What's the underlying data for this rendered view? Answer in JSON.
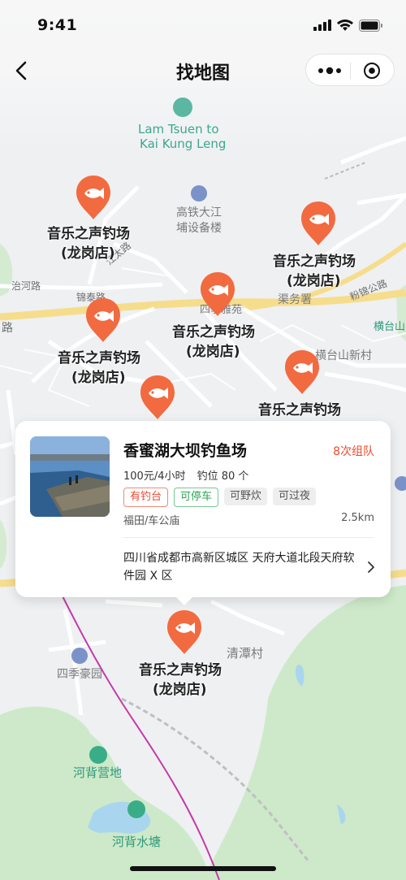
{
  "status_bar": {
    "time": "9:41"
  },
  "nav": {
    "title": "找地图"
  },
  "map_labels": {
    "lam_tsuen": "Lam Tsuen to",
    "kai_kung_leng": "Kai Kung Leng",
    "station_line1": "高铁大江",
    "station_line2": "埔设备楼",
    "zhihe_road": "治河路",
    "jintai_road": "锦泰路",
    "siji_yayuan": "四季雅苑",
    "quwushu": "渠务署",
    "fenjin_road": "粉锦公路",
    "hengtaishan": "横台山",
    "hengtaishan_new": "横台山新村",
    "jiangtai_road": "江太路",
    "road_fragment": "路",
    "siji_haoyuan": "四季豪园",
    "qingtan": "清潭村",
    "hebei_camp": "河背营地",
    "hebei_pond": "河背水塘"
  },
  "pins": [
    {
      "name_line1": "音乐之声钓场",
      "name_line2": "(龙岗店)"
    },
    {
      "name_line1": "音乐之声钓场",
      "name_line2": "(龙岗店)"
    },
    {
      "name_line1": "音乐之声钓场",
      "name_line2": "(龙岗店)"
    },
    {
      "name_line1": "音乐之声钓场",
      "name_line2": "(龙岗店)"
    },
    {
      "name_line1": "音乐之声钓场",
      "name_line2": ""
    },
    {
      "name_line1": "",
      "name_line2": ""
    },
    {
      "name_line1": "音乐之声钓场",
      "name_line2": "(龙岗店)"
    }
  ],
  "card": {
    "name": "香蜜湖大坝钓鱼场",
    "queue": "8次组队",
    "price": "100元/4小时",
    "spots": "钓位 80 个",
    "tags": [
      {
        "label": "有钓台",
        "style": "red"
      },
      {
        "label": "可停车",
        "style": "green"
      },
      {
        "label": "可野炊",
        "style": "gray"
      },
      {
        "label": "可过夜",
        "style": "gray"
      }
    ],
    "location": "福田/车公庙",
    "distance": "2.5km",
    "address": "四川省成都市高新区城区 天府大道北段天府软件园 X 区"
  },
  "colors": {
    "pin": "#f26a3f",
    "tag_red": "#ea4a35",
    "tag_green": "#2da354",
    "queue": "#ee4a2d",
    "water": "#a9d6ee",
    "green_area": "#cce8c8"
  },
  "icons": [
    "back-arrow-icon",
    "more-dots-icon",
    "close-target-icon",
    "fish-icon",
    "signal-icon",
    "wifi-icon",
    "battery-icon",
    "chevron-right-icon"
  ]
}
